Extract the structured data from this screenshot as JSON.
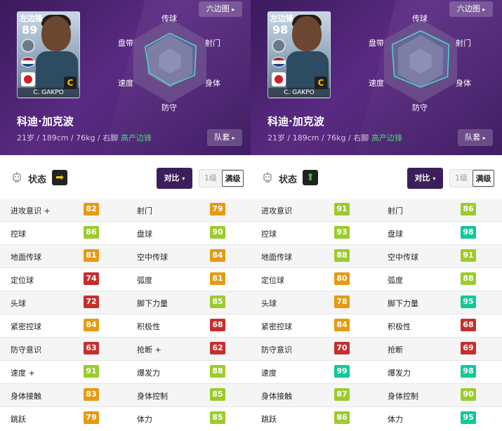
{
  "colors": {
    "header_purple": "#4a2370",
    "radar_fill": "#7a5b98",
    "radar_outline": "#46d9c4",
    "green_text": "#3fd86e",
    "rating_red": "#c62e2e",
    "rating_orange": "#e69a12",
    "rating_yellowgreen": "#9bcc2c",
    "rating_green": "#3ec53a",
    "rating_teal": "#13c899"
  },
  "panels": [
    {
      "card": {
        "position": "左边锋",
        "rating": "89",
        "name": "C. GAKPO",
        "tier": "C"
      },
      "player_name": "科迪·加克波",
      "info": "21岁 / 189cm / 76kg / 右脚",
      "style": "高产边锋",
      "hex_button": "六边图",
      "team_button": "队套",
      "radar_labels": [
        "传球",
        "射门",
        "身体",
        "防守",
        "速度",
        "盘带"
      ],
      "radar_values": [
        0.66,
        0.72,
        0.68,
        0.58,
        0.56,
        0.68
      ],
      "status_label": "状态",
      "status_arrow": "➡",
      "status_color": "#f4c400",
      "compare_button": "对比",
      "level_options": [
        "1级",
        "满级"
      ],
      "attributes": [
        {
          "name": "进攻意识 +",
          "value": "82",
          "color": "#e69a12"
        },
        {
          "name": "射门",
          "value": "79",
          "color": "#e69a12"
        },
        {
          "name": "控球",
          "value": "86",
          "color": "#9bcc2c"
        },
        {
          "name": "盘球",
          "value": "90",
          "color": "#9bcc2c"
        },
        {
          "name": "地面传球",
          "value": "81",
          "color": "#e69a12"
        },
        {
          "name": "空中传球",
          "value": "84",
          "color": "#e69a12"
        },
        {
          "name": "定位球",
          "value": "74",
          "color": "#c62e2e"
        },
        {
          "name": "弧度",
          "value": "81",
          "color": "#e69a12"
        },
        {
          "name": "头球",
          "value": "72",
          "color": "#c62e2e"
        },
        {
          "name": "脚下力量",
          "value": "85",
          "color": "#9bcc2c"
        },
        {
          "name": "紧密控球",
          "value": "84",
          "color": "#e69a12"
        },
        {
          "name": "积极性",
          "value": "68",
          "color": "#c62e2e"
        },
        {
          "name": "防守意识",
          "value": "63",
          "color": "#c62e2e"
        },
        {
          "name": "抢断 +",
          "value": "62",
          "color": "#c62e2e"
        },
        {
          "name": "速度 +",
          "value": "91",
          "color": "#9bcc2c"
        },
        {
          "name": "爆发力",
          "value": "88",
          "color": "#9bcc2c"
        },
        {
          "name": "身体接触",
          "value": "83",
          "color": "#e69a12"
        },
        {
          "name": "身体控制",
          "value": "85",
          "color": "#9bcc2c"
        },
        {
          "name": "跳跃",
          "value": "79",
          "color": "#e69a12"
        },
        {
          "name": "体力",
          "value": "85",
          "color": "#9bcc2c"
        }
      ]
    },
    {
      "card": {
        "position": "左边锋",
        "rating": "98",
        "name": "C. GAKPO",
        "tier": "C"
      },
      "player_name": "科迪·加克波",
      "info": "21岁 / 189cm / 76kg / 右脚",
      "style": "高产边锋",
      "hex_button": "六边图",
      "team_button": "队套",
      "radar_labels": [
        "传球",
        "射门",
        "身体",
        "防守",
        "速度",
        "盘带"
      ],
      "radar_values": [
        0.72,
        0.78,
        0.74,
        0.62,
        0.72,
        0.78
      ],
      "status_label": "状态",
      "status_arrow": "⬆",
      "status_color": "#3ec53a",
      "compare_button": "对比",
      "level_options": [
        "1级",
        "满级"
      ],
      "attributes": [
        {
          "name": "进攻意识",
          "value": "91",
          "color": "#9bcc2c"
        },
        {
          "name": "射门",
          "value": "86",
          "color": "#9bcc2c"
        },
        {
          "name": "控球",
          "value": "93",
          "color": "#9bcc2c"
        },
        {
          "name": "盘球",
          "value": "98",
          "color": "#13c899"
        },
        {
          "name": "地面传球",
          "value": "88",
          "color": "#9bcc2c"
        },
        {
          "name": "空中传球",
          "value": "91",
          "color": "#9bcc2c"
        },
        {
          "name": "定位球",
          "value": "80",
          "color": "#e69a12"
        },
        {
          "name": "弧度",
          "value": "88",
          "color": "#9bcc2c"
        },
        {
          "name": "头球",
          "value": "78",
          "color": "#e69a12"
        },
        {
          "name": "脚下力量",
          "value": "95",
          "color": "#13c899"
        },
        {
          "name": "紧密控球",
          "value": "84",
          "color": "#e69a12"
        },
        {
          "name": "积极性",
          "value": "68",
          "color": "#c62e2e"
        },
        {
          "name": "防守意识",
          "value": "70",
          "color": "#c62e2e"
        },
        {
          "name": "抢断",
          "value": "69",
          "color": "#c62e2e"
        },
        {
          "name": "速度",
          "value": "99",
          "color": "#13c899"
        },
        {
          "name": "爆发力",
          "value": "98",
          "color": "#13c899"
        },
        {
          "name": "身体接触",
          "value": "87",
          "color": "#9bcc2c"
        },
        {
          "name": "身体控制",
          "value": "90",
          "color": "#9bcc2c"
        },
        {
          "name": "跳跃",
          "value": "86",
          "color": "#9bcc2c"
        },
        {
          "name": "体力",
          "value": "95",
          "color": "#13c899"
        }
      ]
    }
  ]
}
